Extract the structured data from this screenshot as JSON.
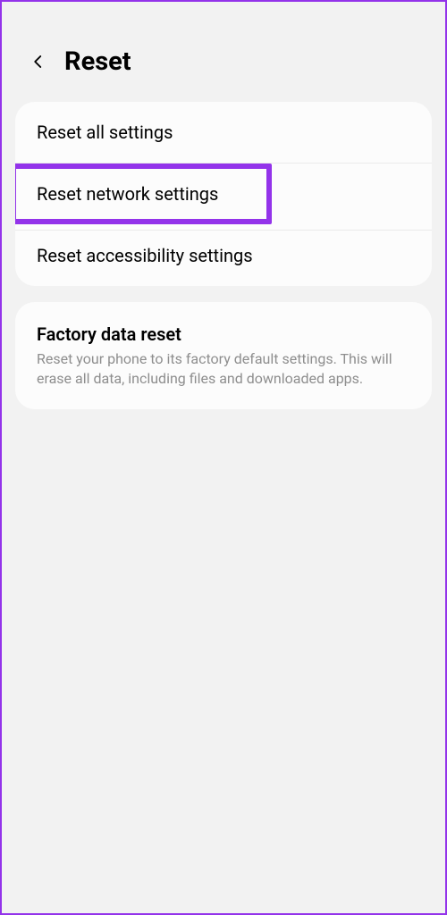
{
  "header": {
    "title": "Reset"
  },
  "group1": {
    "items": [
      {
        "label": "Reset all settings"
      },
      {
        "label": "Reset network settings",
        "highlighted": true
      },
      {
        "label": "Reset accessibility settings"
      }
    ]
  },
  "group2": {
    "title": "Factory data reset",
    "description": "Reset your phone to its factory default settings. This will erase all data, including files and downloaded apps."
  }
}
